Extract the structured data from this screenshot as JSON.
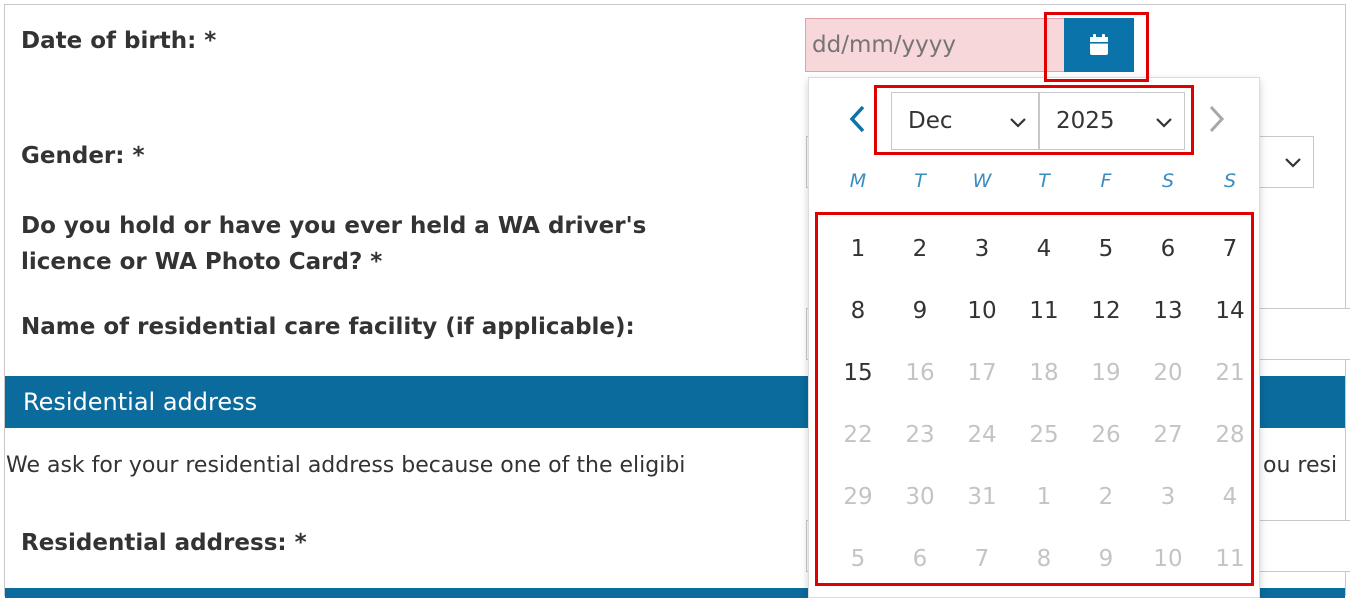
{
  "form": {
    "dob_label": "Date of birth: *",
    "dob_placeholder": "dd/mm/yyyy",
    "gender_label": "Gender: *",
    "wa_licence_label": "Do you hold or have you ever held a WA driver's licence or WA Photo Card? *",
    "facility_label": "Name of residential care facility (if applicable):",
    "section_title": "Residential address",
    "section_desc": "We ask for your residential address because one of the eligibi",
    "section_desc_tail": "ou resi",
    "residential_address_label": "Residential address: *"
  },
  "datepicker": {
    "month": "Dec",
    "year": "2025",
    "weekdays": [
      "M",
      "T",
      "W",
      "T",
      "F",
      "S",
      "S"
    ],
    "weeks": [
      [
        {
          "d": "1",
          "m": false
        },
        {
          "d": "2",
          "m": false
        },
        {
          "d": "3",
          "m": false
        },
        {
          "d": "4",
          "m": false
        },
        {
          "d": "5",
          "m": false
        },
        {
          "d": "6",
          "m": false
        },
        {
          "d": "7",
          "m": false
        }
      ],
      [
        {
          "d": "8",
          "m": false
        },
        {
          "d": "9",
          "m": false
        },
        {
          "d": "10",
          "m": false
        },
        {
          "d": "11",
          "m": false
        },
        {
          "d": "12",
          "m": false
        },
        {
          "d": "13",
          "m": false
        },
        {
          "d": "14",
          "m": false
        }
      ],
      [
        {
          "d": "15",
          "m": false
        },
        {
          "d": "16",
          "m": true
        },
        {
          "d": "17",
          "m": true
        },
        {
          "d": "18",
          "m": true
        },
        {
          "d": "19",
          "m": true
        },
        {
          "d": "20",
          "m": true
        },
        {
          "d": "21",
          "m": true
        }
      ],
      [
        {
          "d": "22",
          "m": true
        },
        {
          "d": "23",
          "m": true
        },
        {
          "d": "24",
          "m": true
        },
        {
          "d": "25",
          "m": true
        },
        {
          "d": "26",
          "m": true
        },
        {
          "d": "27",
          "m": true
        },
        {
          "d": "28",
          "m": true
        }
      ],
      [
        {
          "d": "29",
          "m": true
        },
        {
          "d": "30",
          "m": true
        },
        {
          "d": "31",
          "m": true
        },
        {
          "d": "1",
          "m": true
        },
        {
          "d": "2",
          "m": true
        },
        {
          "d": "3",
          "m": true
        },
        {
          "d": "4",
          "m": true
        }
      ],
      [
        {
          "d": "5",
          "m": true
        },
        {
          "d": "6",
          "m": true
        },
        {
          "d": "7",
          "m": true
        },
        {
          "d": "8",
          "m": true
        },
        {
          "d": "9",
          "m": true
        },
        {
          "d": "10",
          "m": true
        },
        {
          "d": "11",
          "m": true
        }
      ]
    ]
  },
  "colors": {
    "brand_blue": "#0a6b9c",
    "error_fill": "#f7d7da",
    "highlight": "#e00000",
    "weekday_blue": "#3a8dbe"
  },
  "icons": [
    "calendar-icon",
    "chevron-left-icon",
    "chevron-right-icon",
    "chevron-down-icon"
  ]
}
